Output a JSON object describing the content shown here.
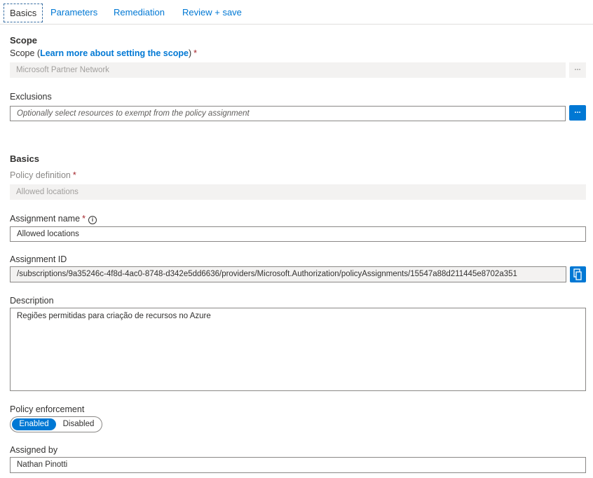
{
  "tabs": [
    {
      "label": "Basics"
    },
    {
      "label": "Parameters"
    },
    {
      "label": "Remediation"
    },
    {
      "label": "Review + save"
    }
  ],
  "scope": {
    "section_title": "Scope",
    "label": "Scope",
    "link_text": "Learn more about setting the scope",
    "required_mark": "*",
    "value": "Microsoft Partner Network",
    "browse_label": "..."
  },
  "exclusions": {
    "label": "Exclusions",
    "placeholder": "Optionally select resources to exempt from the policy assignment",
    "browse_label": "..."
  },
  "basics": {
    "section_title": "Basics",
    "policy_definition": {
      "label": "Policy definition",
      "required_mark": "*",
      "value": "Allowed locations"
    },
    "assignment_name": {
      "label": "Assignment name",
      "required_mark": "*",
      "info_glyph": "i",
      "value": "Allowed locations"
    },
    "assignment_id": {
      "label": "Assignment ID",
      "value": "/subscriptions/9a35246c-4f8d-4ac0-8748-d342e5dd6636/providers/Microsoft.Authorization/policyAssignments/15547a88d211445e8702a351"
    },
    "description": {
      "label": "Description",
      "value": "Regiões permitidas para criação de recursos no Azure"
    },
    "policy_enforcement": {
      "label": "Policy enforcement",
      "options": [
        "Enabled",
        "Disabled"
      ],
      "selected": "Enabled"
    },
    "assigned_by": {
      "label": "Assigned by",
      "value": "Nathan Pinotti"
    }
  },
  "colors": {
    "accent": "#0078d4",
    "required": "#a4262c",
    "disabled_bg": "#f3f2f1"
  },
  "icons": {
    "copy": "copy-icon",
    "info": "info-icon"
  }
}
